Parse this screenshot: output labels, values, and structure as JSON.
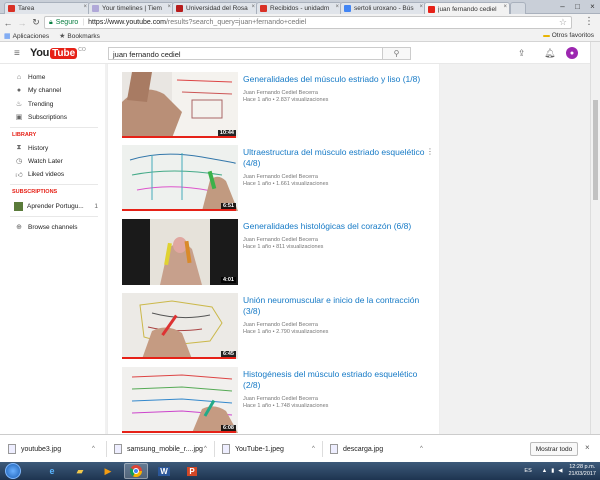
{
  "browser": {
    "tabs": [
      {
        "label": "Tarea",
        "color": "#d93025"
      },
      {
        "label": "Your timelines | Tiem",
        "color": "#b0a8d8"
      },
      {
        "label": "Universidad del Rosa",
        "color": "#b71c1c"
      },
      {
        "label": "Recibidos - unidadm",
        "color": "#d93025"
      },
      {
        "label": "sertoli uroxano - Bús",
        "color": "#4285f4"
      },
      {
        "label": "juan fernando cediel",
        "color": "#e62117"
      }
    ],
    "secure_label": "Seguro",
    "url_host": "https://www.youtube.com",
    "url_path": "/results?search_query=juan+fernando+cediel",
    "bookmarks": [
      {
        "label": "Aplicaciones",
        "icon": "apps-icon"
      },
      {
        "label": "Bookmarks",
        "icon": "star-icon"
      }
    ],
    "other_bookmarks": "Otros favoritos"
  },
  "youtube": {
    "logo_you": "You",
    "logo_tube": "Tube",
    "logo_country": "CO",
    "search_value": "juan fernando cediel",
    "avatar_letter": "●"
  },
  "sidebar": {
    "items": [
      {
        "label": "Home",
        "icon": "home-icon"
      },
      {
        "label": "My channel",
        "icon": "person-icon"
      },
      {
        "label": "Trending",
        "icon": "flame-icon"
      },
      {
        "label": "Subscriptions",
        "icon": "subscriptions-icon"
      }
    ],
    "library_heading": "LIBRARY",
    "library": [
      {
        "label": "History",
        "icon": "history-icon"
      },
      {
        "label": "Watch Later",
        "icon": "clock-icon"
      },
      {
        "label": "Liked videos",
        "icon": "thumbs-up-icon"
      }
    ],
    "subs_heading": "SUBSCRIPTIONS",
    "subscription": {
      "label": "Aprender Portugu...",
      "count": "1"
    },
    "browse_channels": "Browse channels"
  },
  "results": [
    {
      "title": "Generalidades del músculo estriado y liso (1/8)",
      "channel": "Juan Fernando Cediel Becerra",
      "meta": "Hace 1 año • 2.837 visualizaciones",
      "duration": "10:44",
      "progress": 0.98
    },
    {
      "title": "Ultraestructura del músculo estriado esquelético (4/8)",
      "channel": "Juan Fernando Cediel Becerra",
      "meta": "Hace 1 año • 1.661 visualizaciones",
      "duration": "6:51",
      "progress": 0.98
    },
    {
      "title": "Generalidades histológicas del corazón (6/8)",
      "channel": "Juan Fernando Cediel Becerra",
      "meta": "Hace 1 año • 811 visualizaciones",
      "duration": "4:01",
      "progress": 0
    },
    {
      "title": "Unión neuromuscular e inicio de la contracción (3/8)",
      "channel": "Juan Fernando Cediel Becerra",
      "meta": "Hace 1 año • 2.790 visualizaciones",
      "duration": "6:45",
      "progress": 0.98
    },
    {
      "title": "Histogénesis del músculo estriado esquelético (2/8)",
      "channel": "Juan Fernando Cediel Becerra",
      "meta": "Hace 1 año • 1.748 visualizaciones",
      "duration": "6:08",
      "progress": 0.98
    }
  ],
  "downloads": {
    "items": [
      {
        "label": "youtube3.jpg"
      },
      {
        "label": "samsung_mobile_r....jpg"
      },
      {
        "label": "YouTube-1.jpeg"
      },
      {
        "label": "descarga.jpg"
      }
    ],
    "show_all": "Mostrar todo"
  },
  "taskbar": {
    "language": "ES",
    "time": "12:28 p.m.",
    "date": "21/03/2017"
  }
}
